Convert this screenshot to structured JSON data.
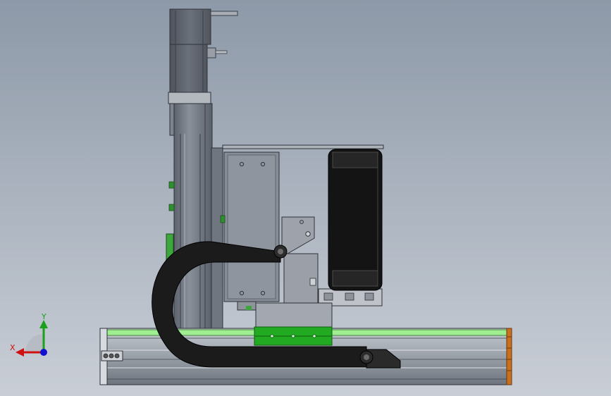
{
  "viewport": {
    "background_top": "#8d99a8",
    "background_bottom": "#c9ced6"
  },
  "triad": {
    "x_label": "X",
    "y_label": "Y",
    "x_color": "#d01010",
    "y_color": "#1aa01a",
    "z_color": "#1010d0"
  },
  "colors": {
    "metal_dark": "#4b5058",
    "metal_mid": "#7b818b",
    "metal_light": "#b9bec6",
    "profile_highlight": "#9fee92",
    "carriage_green": "#22aa22",
    "cable_chain": "#1b1b1b",
    "end_cap_orange": "#c8701e",
    "roller_black": "#141414"
  }
}
